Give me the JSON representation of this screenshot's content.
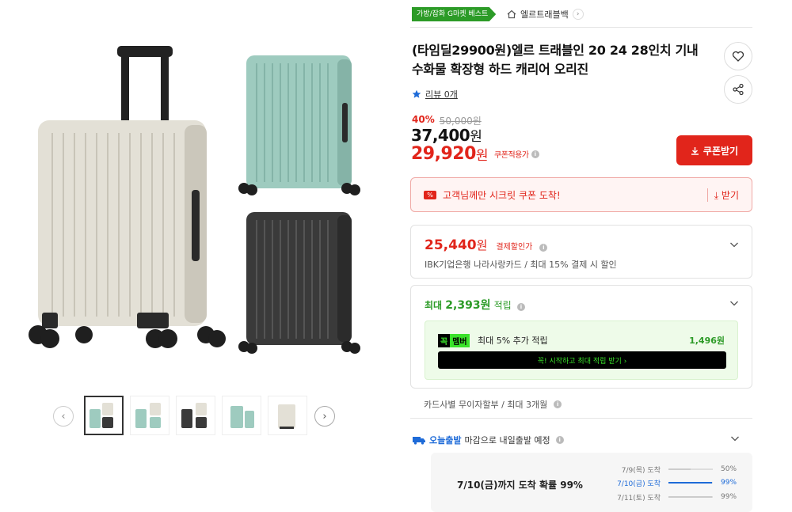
{
  "gallery": {
    "thumbnails": [
      {
        "variant": "mint-white-black"
      },
      {
        "variant": "mint-white"
      },
      {
        "variant": "black-white"
      },
      {
        "variant": "mint"
      },
      {
        "variant": "white"
      }
    ],
    "prev_icon": "chevron-left-icon",
    "next_icon": "chevron-right-icon"
  },
  "topbar": {
    "best_badge": "가방/잡화 G마켓 베스트",
    "store_name": "엘르트래블백"
  },
  "product": {
    "title": "(타임딜29900원)엘르 트래블인 20 24 28인치 기내 수화물 확장형 하드 캐리어 오리진",
    "review_label": "리뷰 0개",
    "discount_pct": "40%",
    "original_price": "50,000원",
    "sale_price": "37,400",
    "coupon_price": "29,920",
    "won": "원",
    "coupon_note": "쿠폰적용가",
    "coupon_button": "쿠폰받기"
  },
  "secret_coupon": {
    "text": "고객님께만 시크릿 쿠폰 도착!",
    "receive": "받기"
  },
  "payment_discount": {
    "price": "25,440",
    "won": "원",
    "label": "결제할인가",
    "sub": "IBK기업은행 나라사랑카드 / 최대 15% 결제 시 할인"
  },
  "points": {
    "prefix": "최대",
    "amount": "2,393원",
    "label": "적립",
    "member_tag_a": "꼭",
    "member_tag_b": "멤버",
    "member_desc": "최대 5% 추가 적립",
    "member_points": "1,496원",
    "start_button": "꼭! 시작하고 최대 적립 받기 ›"
  },
  "installment": "카드사별 무이자할부 / 최대 3개월",
  "delivery": {
    "brand": "오늘출발",
    "text": "마감으로 내일출발 예정",
    "headline": "7/10(금)까지 도착 확률 99%",
    "rows": [
      {
        "date": "7/9(목) 도착",
        "pct": "50%",
        "value": 50
      },
      {
        "date": "7/10(금) 도착",
        "pct": "99%",
        "value": 99
      },
      {
        "date": "7/11(토) 도착",
        "pct": "99%",
        "value": 99
      }
    ]
  },
  "colors": {
    "accent_red": "#e1251b",
    "accent_green": "#2c9b27",
    "accent_blue": "#1e6bd8"
  }
}
